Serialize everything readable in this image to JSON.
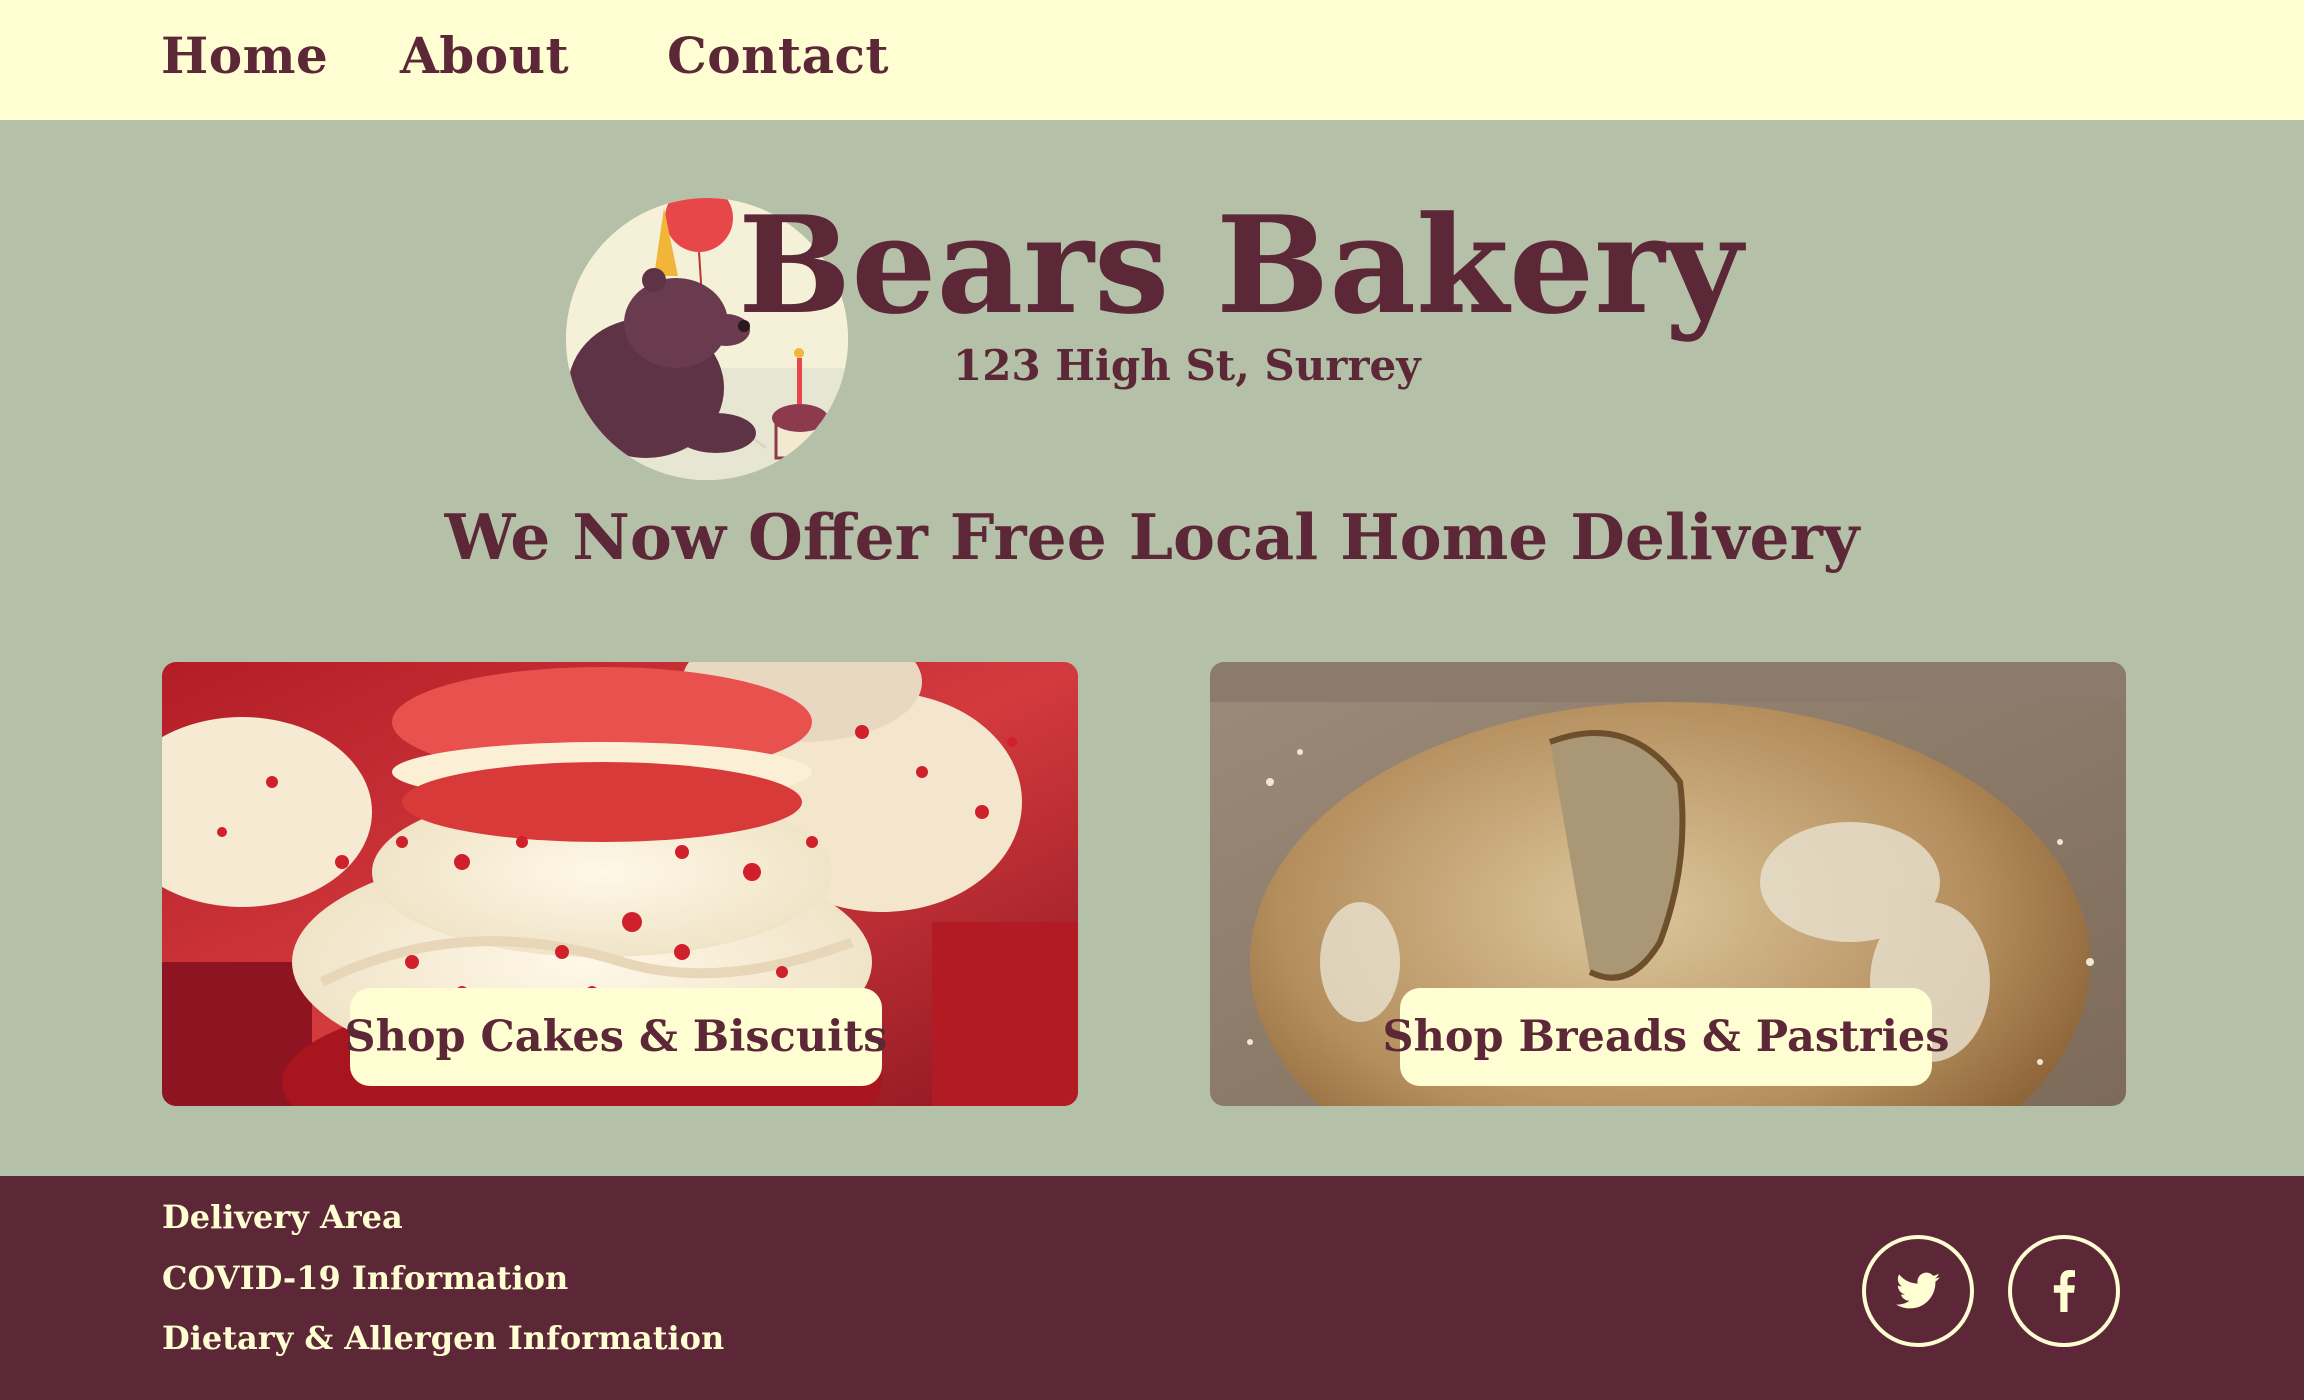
{
  "nav": {
    "items": [
      {
        "label": "Home"
      },
      {
        "label": "About"
      },
      {
        "label": "Contact"
      }
    ]
  },
  "brand": {
    "title": "Bears Bakery",
    "address": "123 High St, Surrey",
    "logo_icon": "bear-birthday-logo-icon"
  },
  "headline": "We Now Offer Free Local Home Delivery",
  "cards": [
    {
      "button_label": "Shop Cakes & Biscuits",
      "image": "red-velvet-cupcakes-photo"
    },
    {
      "button_label": "Shop Breads & Pastries",
      "image": "sourdough-loaf-photo"
    }
  ],
  "footer": {
    "links": [
      {
        "label": "Delivery Area"
      },
      {
        "label": "COVID-19 Information"
      },
      {
        "label": "Dietary & Allergen Information"
      }
    ],
    "social": [
      {
        "name": "twitter-icon"
      },
      {
        "name": "facebook-icon"
      }
    ]
  },
  "colors": {
    "nav_bg": "#fefed2",
    "page_bg": "#b5c0a8",
    "brand_maroon": "#5c2837",
    "footer_bg": "#5c2837"
  }
}
